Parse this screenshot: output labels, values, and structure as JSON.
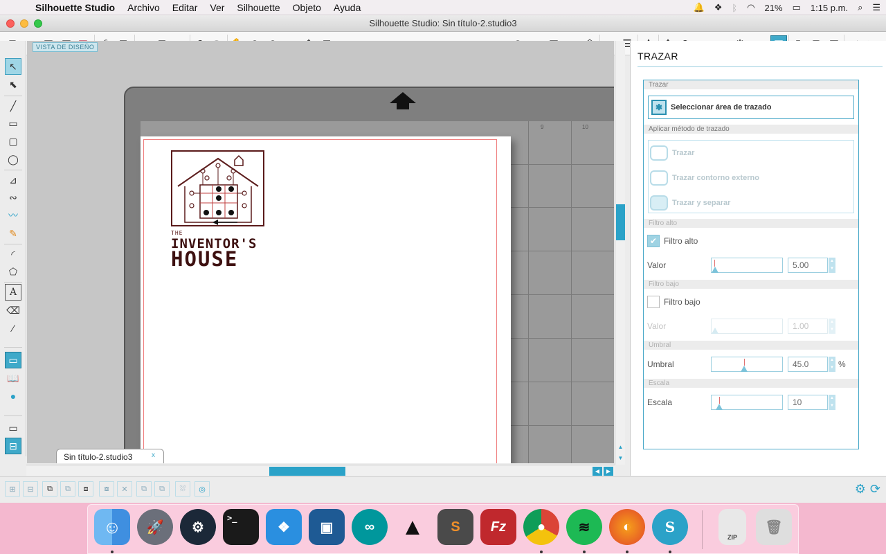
{
  "menubar": {
    "app_name": "Silhouette Studio",
    "menus": [
      "Archivo",
      "Editar",
      "Ver",
      "Silhouette",
      "Objeto",
      "Ayuda"
    ],
    "battery": "21%",
    "time": "1:15 p.m."
  },
  "window": {
    "title": "Silhouette Studio: Sin título-2.studio3"
  },
  "canvas": {
    "view_label": "VISTA DE DISEÑO",
    "grid_numbers": [
      "9",
      "10"
    ],
    "document_tab": "Sin título-2.studio3",
    "document_tab_close": "x"
  },
  "logo": {
    "line1": "THE",
    "line2": "INVENTOR'S",
    "line3": "HOUSE"
  },
  "panel": {
    "title": "TRAZAR",
    "section_trazar": "Trazar",
    "select_area": "Seleccionar área de trazado",
    "section_method": "Aplicar método de trazado",
    "methods": [
      "Trazar",
      "Trazar contorno externo",
      "Trazar y separar"
    ],
    "section_high": "Filtro alto",
    "high_checkbox": "Filtro alto",
    "high_checked": true,
    "high_value_label": "Valor",
    "high_value": "5.00",
    "section_low": "Filtro bajo",
    "low_checkbox": "Filtro bajo",
    "low_checked": false,
    "low_value_label": "Valor",
    "low_value": "1.00",
    "section_threshold": "Umbral",
    "threshold_label": "Umbral",
    "threshold_value": "45.0",
    "threshold_unit": "%",
    "section_scale": "Escala",
    "scale_label": "Escala",
    "scale_value": "10"
  },
  "dock": {
    "apps": [
      "finder-icon",
      "launchpad-icon",
      "steam-icon",
      "terminal-icon",
      "dropbox-icon",
      "virtualbox-icon",
      "arduino-icon",
      "inkscape-icon",
      "sublime-icon",
      "filezilla-icon",
      "chrome-icon",
      "spotify-icon",
      "firefox-icon",
      "silhouette-icon",
      "zip-icon",
      "trash-icon"
    ],
    "zip_label": "ZIP"
  },
  "colors": {
    "accent": "#2ba2c8",
    "desktop": "#f4b8cf",
    "logo": "#3d1010"
  }
}
